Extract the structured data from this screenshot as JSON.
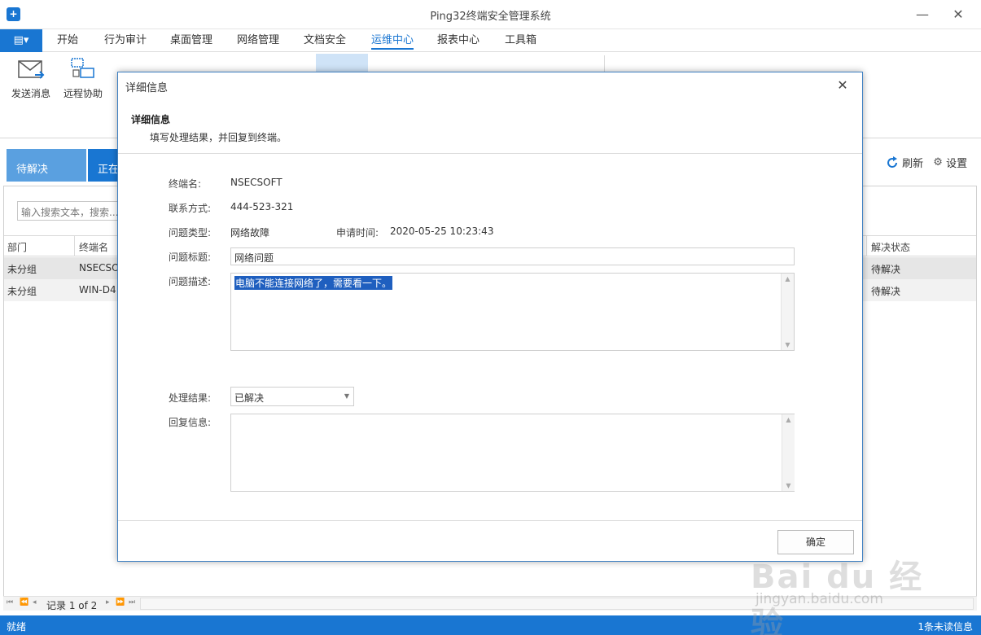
{
  "window": {
    "title": "Ping32终端安全管理系统",
    "icon": "shield-icon",
    "minimize": "—",
    "maximize": "✕"
  },
  "ribbon": {
    "app_menu_icon": "menu-icon",
    "tabs": [
      {
        "label": "开始"
      },
      {
        "label": "行为审计"
      },
      {
        "label": "桌面管理"
      },
      {
        "label": "网络管理"
      },
      {
        "label": "文档安全"
      },
      {
        "label": "运维中心",
        "active": true
      },
      {
        "label": "报表中心"
      },
      {
        "label": "工具箱"
      }
    ],
    "buttons": [
      {
        "label": "发送消息",
        "icon": "envelope-icon"
      },
      {
        "label": "远程协助",
        "icon": "remote-desktop-icon"
      }
    ]
  },
  "status_tabs": {
    "pending": "待解决",
    "in_progress": "正在"
  },
  "toolbar": {
    "refresh": "刷新",
    "settings": "设置"
  },
  "search": {
    "placeholder": "输入搜索文本，搜索..."
  },
  "grid": {
    "columns": [
      "部门",
      "终端名",
      "解决状态"
    ],
    "rows": [
      {
        "dept": "未分组",
        "terminal": "NSECSO",
        "status": "待解决"
      },
      {
        "dept": "未分组",
        "terminal": "WIN-D4",
        "status": "待解决"
      }
    ]
  },
  "pager": {
    "text": "记录 1 of 2"
  },
  "statusbar": {
    "status": "就绪",
    "unread": "1条未读信息"
  },
  "dialog": {
    "window_title": "详细信息",
    "header_title": "详细信息",
    "header_subtitle": "填写处理结果，并回复到终端。",
    "terminal_label": "终端名:",
    "terminal_value": "NSECSOFT",
    "contact_label": "联系方式:",
    "contact_value": "444-523-321",
    "type_label": "问题类型:",
    "type_value": "网络故障",
    "time_label": "申请时间:",
    "time_value": "2020-05-25 10:23:43",
    "title_label": "问题标题:",
    "title_value": "网络问题",
    "desc_label": "问题描述:",
    "desc_value": "电脑不能连接网络了，需要看一下。",
    "result_label": "处理结果:",
    "result_value": "已解决",
    "reply_label": "回复信息:",
    "reply_value": "",
    "ok_button": "确定"
  },
  "watermark": {
    "logo": "Bai du 经验",
    "url": "jingyan.baidu.com"
  }
}
